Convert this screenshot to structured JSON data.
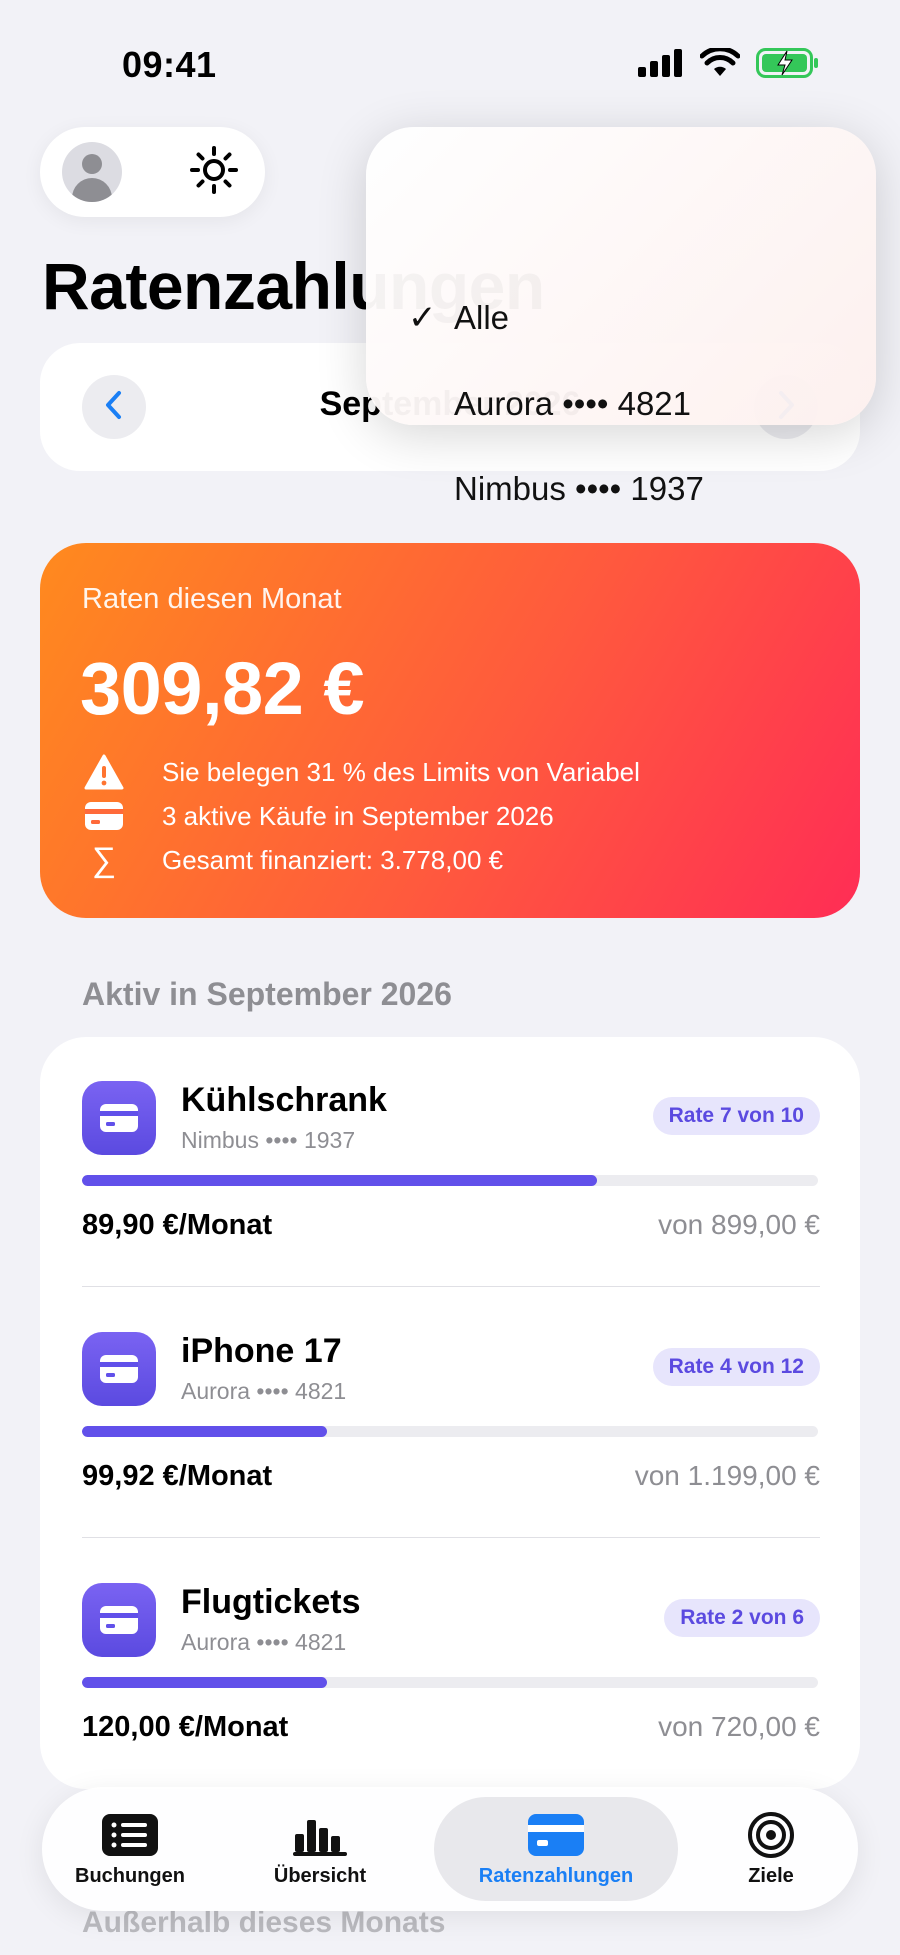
{
  "status_bar": {
    "time": "09:41"
  },
  "header": {
    "title": "Ratenzahlungen"
  },
  "month_nav": {
    "label": "September 2026"
  },
  "card_filter": {
    "items": [
      {
        "label": "Alle",
        "selected": true
      },
      {
        "label": "Aurora •••• 4821",
        "selected": false
      },
      {
        "label": "Nimbus •••• 1937",
        "selected": false
      }
    ]
  },
  "summary": {
    "label": "Raten diesen Monat",
    "amount": "309,82 €",
    "rows": [
      {
        "icon": "warning-icon",
        "text": "Sie belegen 31 % des Limits von Variabel"
      },
      {
        "icon": "credit-card-icon",
        "text": "3 aktive Käufe in September 2026"
      },
      {
        "icon": "sigma-icon",
        "text": "Gesamt finanziert: 3.778,00 €"
      }
    ],
    "colors": {
      "start": "#ff8a1e",
      "end": "#ff2d55"
    }
  },
  "active_section": {
    "header": "Aktiv in September 2026",
    "items": [
      {
        "title": "Kühlschrank",
        "card": "Nimbus •••• 1937",
        "badge": "Rate 7 von 10",
        "progress": 0.7,
        "monthly": "89,90 €/Monat",
        "total": "von 899,00 €"
      },
      {
        "title": "iPhone 17",
        "card": "Aurora •••• 4821",
        "badge": "Rate 4 von 12",
        "progress": 0.3333,
        "monthly": "99,92 €/Monat",
        "total": "von 1.199,00 €"
      },
      {
        "title": "Flugtickets",
        "card": "Aurora •••• 4821",
        "badge": "Rate 2 von 6",
        "progress": 0.3333,
        "monthly": "120,00 €/Monat",
        "total": "von 720,00 €"
      }
    ]
  },
  "below_section": {
    "header": "Außerhalb dieses Monats"
  },
  "tab_bar": {
    "tabs": [
      {
        "label": "Buchungen",
        "icon": "list-icon",
        "active": false
      },
      {
        "label": "Übersicht",
        "icon": "bar-chart-icon",
        "active": false
      },
      {
        "label": "Ratenzahlungen",
        "icon": "credit-card-icon",
        "active": true
      },
      {
        "label": "Ziele",
        "icon": "target-icon",
        "active": false
      }
    ],
    "accent": "#1a7ff5"
  }
}
